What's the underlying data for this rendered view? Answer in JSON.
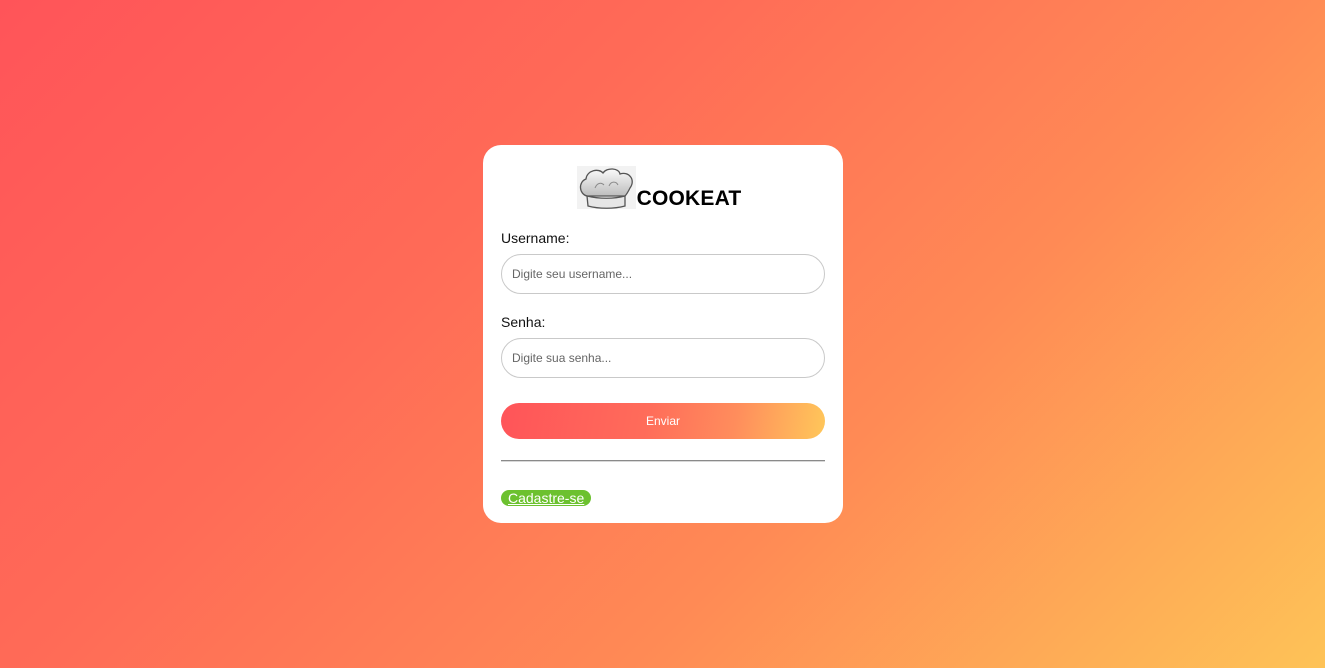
{
  "brand": {
    "name": "COOKEAT",
    "logo_icon": "chef-hat-icon"
  },
  "form": {
    "username_label": "Username:",
    "username_placeholder": "Digite seu username...",
    "username_value": "",
    "password_label": "Senha:",
    "password_placeholder": "Digite sua senha...",
    "password_value": "",
    "submit_label": "Enviar"
  },
  "footer": {
    "signup_label": "Cadastre-se"
  },
  "colors": {
    "background_start": "#ff5459",
    "background_end": "#fec357",
    "signup_bg": "#6cc12f",
    "card_bg": "#ffffff"
  }
}
